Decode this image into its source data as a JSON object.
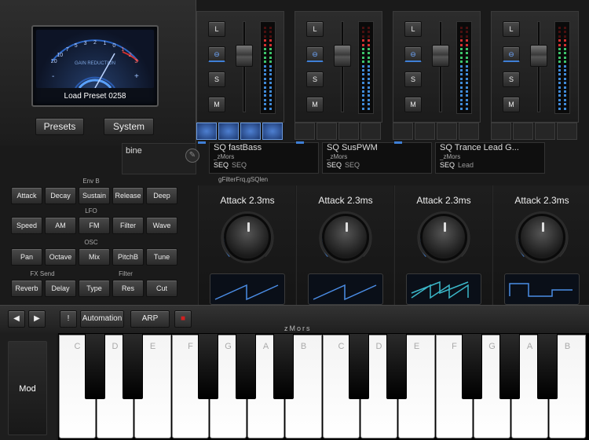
{
  "meter": {
    "scale_labels": [
      "20",
      "10",
      "7",
      "5",
      "3",
      "2",
      "1",
      "0",
      "1",
      "2",
      "3"
    ],
    "caption": "GAIN REDUCTION",
    "preset_label": "Load Preset 0258"
  },
  "main_buttons": {
    "presets": "Presets",
    "system": "System"
  },
  "strips": [
    {
      "btns": [
        "L",
        "⊖",
        "S",
        "M"
      ],
      "grid_on": [
        true,
        true,
        true,
        true
      ]
    },
    {
      "btns": [
        "L",
        "⊖",
        "S",
        "M"
      ],
      "grid_on": [
        false,
        false,
        false,
        false
      ]
    },
    {
      "btns": [
        "L",
        "⊖",
        "S",
        "M"
      ],
      "grid_on": [
        false,
        false,
        false,
        false
      ]
    },
    {
      "btns": [
        "L",
        "⊖",
        "S",
        "M"
      ],
      "grid_on": [
        false,
        false,
        false,
        false
      ]
    }
  ],
  "presets": [
    {
      "name": "SQ fastBass",
      "author": "_zMors",
      "tags": [
        "SEQ",
        "SEQ"
      ],
      "sub": "gFilterFrq,gSQlen"
    },
    {
      "name": "SQ SusPWM",
      "author": "_zMors",
      "tags": [
        "SEQ",
        "SEQ"
      ],
      "sub": ""
    },
    {
      "name": "SQ Trance Lead G...",
      "author": "_zMors",
      "tags": [
        "SEQ",
        "Lead"
      ],
      "sub": ""
    }
  ],
  "partial_label": "bine",
  "params": {
    "env_b_label": "Env B",
    "lfo_label": "LFO",
    "osc_label": "OSC",
    "fx_label": "FX Send",
    "filter_label": "Filter",
    "row1": [
      "Attack",
      "Decay",
      "Sustain",
      "Release",
      "Deep"
    ],
    "row2": [
      "Speed",
      "AM",
      "FM",
      "Filter",
      "Wave"
    ],
    "row3": [
      "Pan",
      "Octave",
      "Mix",
      "PitchB",
      "Tune"
    ],
    "row4": [
      "Reverb",
      "Delay",
      "Type",
      "Res",
      "Cut"
    ]
  },
  "knobs": [
    {
      "label": "Attack 2.3ms",
      "wave": "saw"
    },
    {
      "label": "Attack 2.3ms",
      "wave": "saw"
    },
    {
      "label": "Attack 2.3ms",
      "wave": "saw-multi"
    },
    {
      "label": "Attack 2.3ms",
      "wave": "square"
    }
  ],
  "transport": {
    "prev": "◀",
    "next": "▶",
    "excl": "!",
    "automation": "Automation",
    "arp": "ARP",
    "record": "■"
  },
  "brand": "zMors",
  "mod_label": "Mod",
  "white_keys": [
    "C",
    "D",
    "E",
    "F",
    "G",
    "A",
    "B",
    "C",
    "D",
    "E",
    "F",
    "G",
    "A",
    "B"
  ],
  "colors": {
    "accent": "#3f7fd6",
    "record": "#d22020",
    "led_green": "#3cc46a",
    "led_blue": "#3f8ad8",
    "led_red": "#d23030"
  }
}
